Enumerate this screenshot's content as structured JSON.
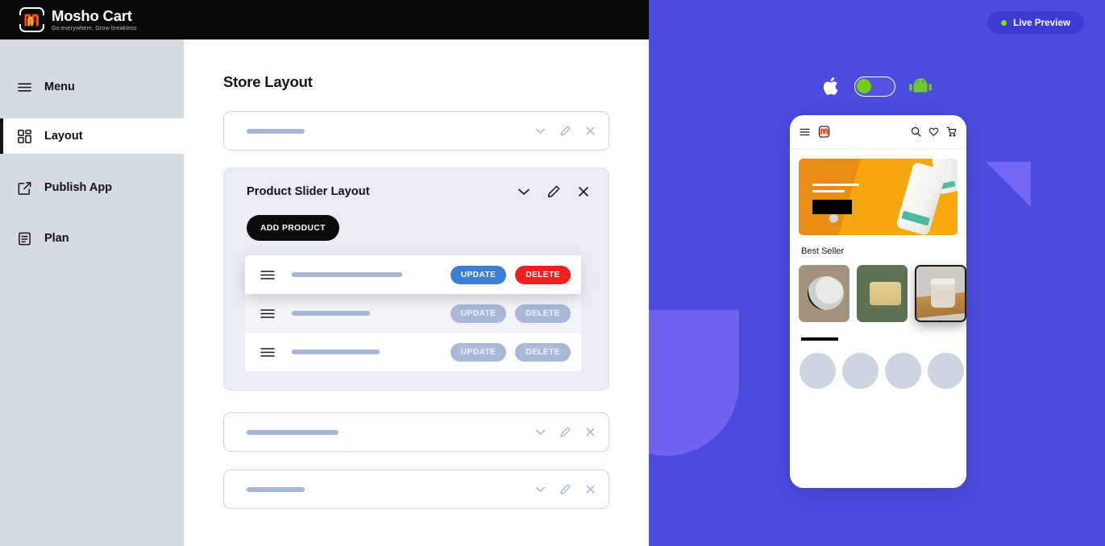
{
  "brand": {
    "name": "Mosho Cart",
    "tagline": "Go everywhere, Grow breakless",
    "logo_icon": "mosho-m-logo"
  },
  "sidebar": {
    "items": [
      {
        "label": "Menu",
        "icon": "hamburger-icon",
        "active": false
      },
      {
        "label": "Layout",
        "icon": "grid-icon",
        "active": true
      },
      {
        "label": "Publish App",
        "icon": "external-link-icon",
        "active": false
      },
      {
        "label": "Plan",
        "icon": "document-list-icon",
        "active": false
      }
    ]
  },
  "main": {
    "page_title": "Store Layout",
    "collapsed_cards_top": [
      {
        "placeholder_width": 72
      }
    ],
    "slider_card": {
      "title": "Product Slider Layout",
      "add_product_label": "ADD PRODUCT",
      "icons": [
        "chevron-down-icon",
        "pencil-icon",
        "close-icon"
      ],
      "rows": [
        {
          "state": "dragging",
          "placeholder_width": 137,
          "update_label": "UPDATE",
          "delete_label": "DELETE"
        },
        {
          "state": "muted",
          "placeholder_width": 97,
          "update_label": "UPDATE",
          "delete_label": "DELETE"
        },
        {
          "state": "muted",
          "placeholder_width": 109,
          "update_label": "UPDATE",
          "delete_label": "DELETE"
        }
      ]
    },
    "collapsed_cards_bottom": [
      {
        "placeholder_width": 114
      },
      {
        "placeholder_width": 72
      }
    ],
    "card_icons": [
      "chevron-down-icon",
      "pencil-icon",
      "close-icon"
    ]
  },
  "preview": {
    "live_preview_label": "Live Preview",
    "status_dot_color": "#86d927",
    "os_switch": {
      "left_icon": "apple-icon",
      "right_icon": "android-icon",
      "toggle_state": "left",
      "knob_color": "#76cc11"
    },
    "phone": {
      "header_icons": [
        "hamburger-icon",
        "mosho-logo-icon",
        "search-icon",
        "heart-icon",
        "cart-icon"
      ],
      "banner": {
        "style": "orange-skincare-banner",
        "has_black_button": true
      },
      "section_title": "Best Seller",
      "thumbnails": [
        {
          "name": "thumb-tan-lid",
          "selected": false
        },
        {
          "name": "thumb-green-jar",
          "selected": false
        },
        {
          "name": "thumb-candle-tray",
          "selected": true
        }
      ],
      "circle_placeholders": 4
    }
  },
  "colors": {
    "brand_black": "#0a0a0a",
    "sidebar_bg": "#d5dbe3",
    "preview_bg": "#4a4ce0",
    "preview_deco": "#7468f2",
    "live_preview_pill": "#3b3cd2",
    "update_blue": "#3b7fd4",
    "delete_red": "#f21f21",
    "muted_button": "#a8bad8",
    "placeholder_bar": "#a5b6d6",
    "slider_card_bg": "#e9edf4"
  }
}
